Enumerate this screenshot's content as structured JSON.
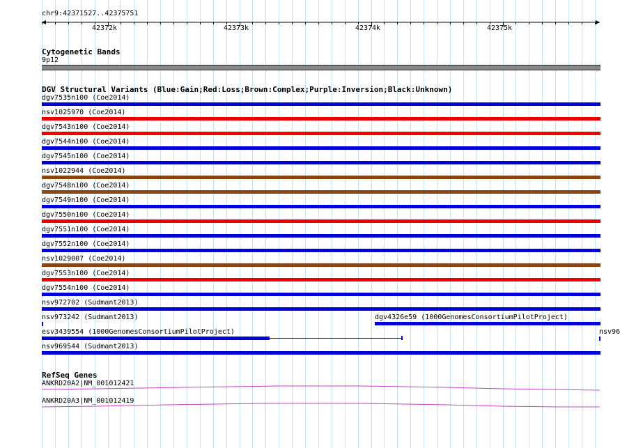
{
  "colors": {
    "gain": "#0000dd",
    "loss": "#ee0000",
    "complex": "#8b4513",
    "gene": "#c840c8",
    "grid": "#c6e2ef"
  },
  "ruler": {
    "coordinate": "chr9:42371527..42375751",
    "ticks": [
      "42372k",
      "42373k",
      "42374k",
      "42375k"
    ]
  },
  "cytobands": {
    "title": "Cytogenetic Bands",
    "band": "9p12"
  },
  "dgv": {
    "title": "DGV Structural Variants (Blue:Gain;Red:Loss;Brown:Complex;Purple:Inversion;Black:Unknown)",
    "variants": [
      {
        "label": "dgv7535n100 (Coe2014)",
        "type": "gain"
      },
      {
        "label": "nsv1025970 (Coe2014)",
        "type": "loss"
      },
      {
        "label": "dgv7543n100 (Coe2014)",
        "type": "loss"
      },
      {
        "label": "dgv7544n100 (Coe2014)",
        "type": "gain"
      },
      {
        "label": "dgv7545n100 (Coe2014)",
        "type": "gain"
      },
      {
        "label": "nsv1022944 (Coe2014)",
        "type": "complex"
      },
      {
        "label": "dgv7548n100 (Coe2014)",
        "type": "complex"
      },
      {
        "label": "dgv7549n100 (Coe2014)",
        "type": "gain"
      },
      {
        "label": "dgv7550n100 (Coe2014)",
        "type": "loss"
      },
      {
        "label": "dgv7551n100 (Coe2014)",
        "type": "gain"
      },
      {
        "label": "dgv7552n100 (Coe2014)",
        "type": "gain"
      },
      {
        "label": "nsv1029007 (Coe2014)",
        "type": "complex"
      },
      {
        "label": "dgv7553n100 (Coe2014)",
        "type": "loss"
      },
      {
        "label": "dgv7554n100 (Coe2014)",
        "type": "gain"
      },
      {
        "label": "nsv972702 (Sudmant2013)",
        "type": "gain"
      },
      {
        "label": "nsv973242 (Sudmant2013)",
        "type": "gain"
      },
      {
        "label": "dgv4326e59 (1000GenomesConsortiumPilotProject)",
        "type": "gain"
      },
      {
        "label": "esv3439554 (1000GenomesConsortiumPilotProject)",
        "type": "gain"
      },
      {
        "label": "nsv96",
        "type": "gain"
      },
      {
        "label": "nsv969544 (Sudmant2013)",
        "type": "gain"
      }
    ]
  },
  "refseq": {
    "title": "RefSeq Genes",
    "genes": [
      {
        "label": "ANKRD20A2|NM_001012421"
      },
      {
        "label": "ANKRD20A3|NM_001012419"
      }
    ]
  }
}
